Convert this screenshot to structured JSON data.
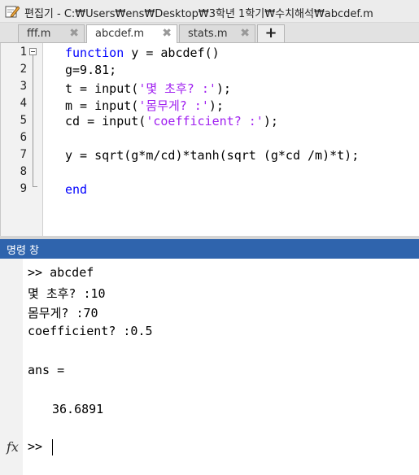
{
  "window": {
    "title": "편집기 - C:₩Users₩ens₩Desktop₩3학년 1학기₩수치해석₩abcdef.m",
    "icon": "editor-pencil-icon"
  },
  "tabs": [
    {
      "label": "fff.m",
      "active": false
    },
    {
      "label": "abcdef.m",
      "active": true
    },
    {
      "label": "stats.m",
      "active": false
    }
  ],
  "tab_close_glyph": "✖",
  "add_tab_glyph": "+",
  "editor": {
    "line_numbers": [
      "1",
      "2",
      "3",
      "4",
      "5",
      "6",
      "7",
      "8",
      "9"
    ],
    "lines": {
      "l1_kw": "function",
      "l1_rest": " y = abcdef()",
      "l2": "g=9.81;",
      "l3_a": "t = input(",
      "l3_str": "'몇 초후? :'",
      "l3_b": ");",
      "l4_a": "m = input(",
      "l4_str": "'몸무게? :'",
      "l4_b": ");",
      "l5_a": "cd = input(",
      "l5_str": "'coefficient? :'",
      "l5_b": ");",
      "l7": "y = sqrt(g*m/cd)*tanh(sqrt (g*cd /m)*t);",
      "l9_kw": "end"
    }
  },
  "command_window": {
    "title": "명령 창",
    "lines": [
      ">> abcdef",
      "몇 초후? :10",
      "몸무게? :70",
      "coefficient? :0.5",
      "ans =",
      "36.6891"
    ],
    "fx_label": "fx",
    "prompt": ">>"
  },
  "colors": {
    "keyword": "#0000ff",
    "string": "#a020f0",
    "command_header": "#2f64ad"
  }
}
